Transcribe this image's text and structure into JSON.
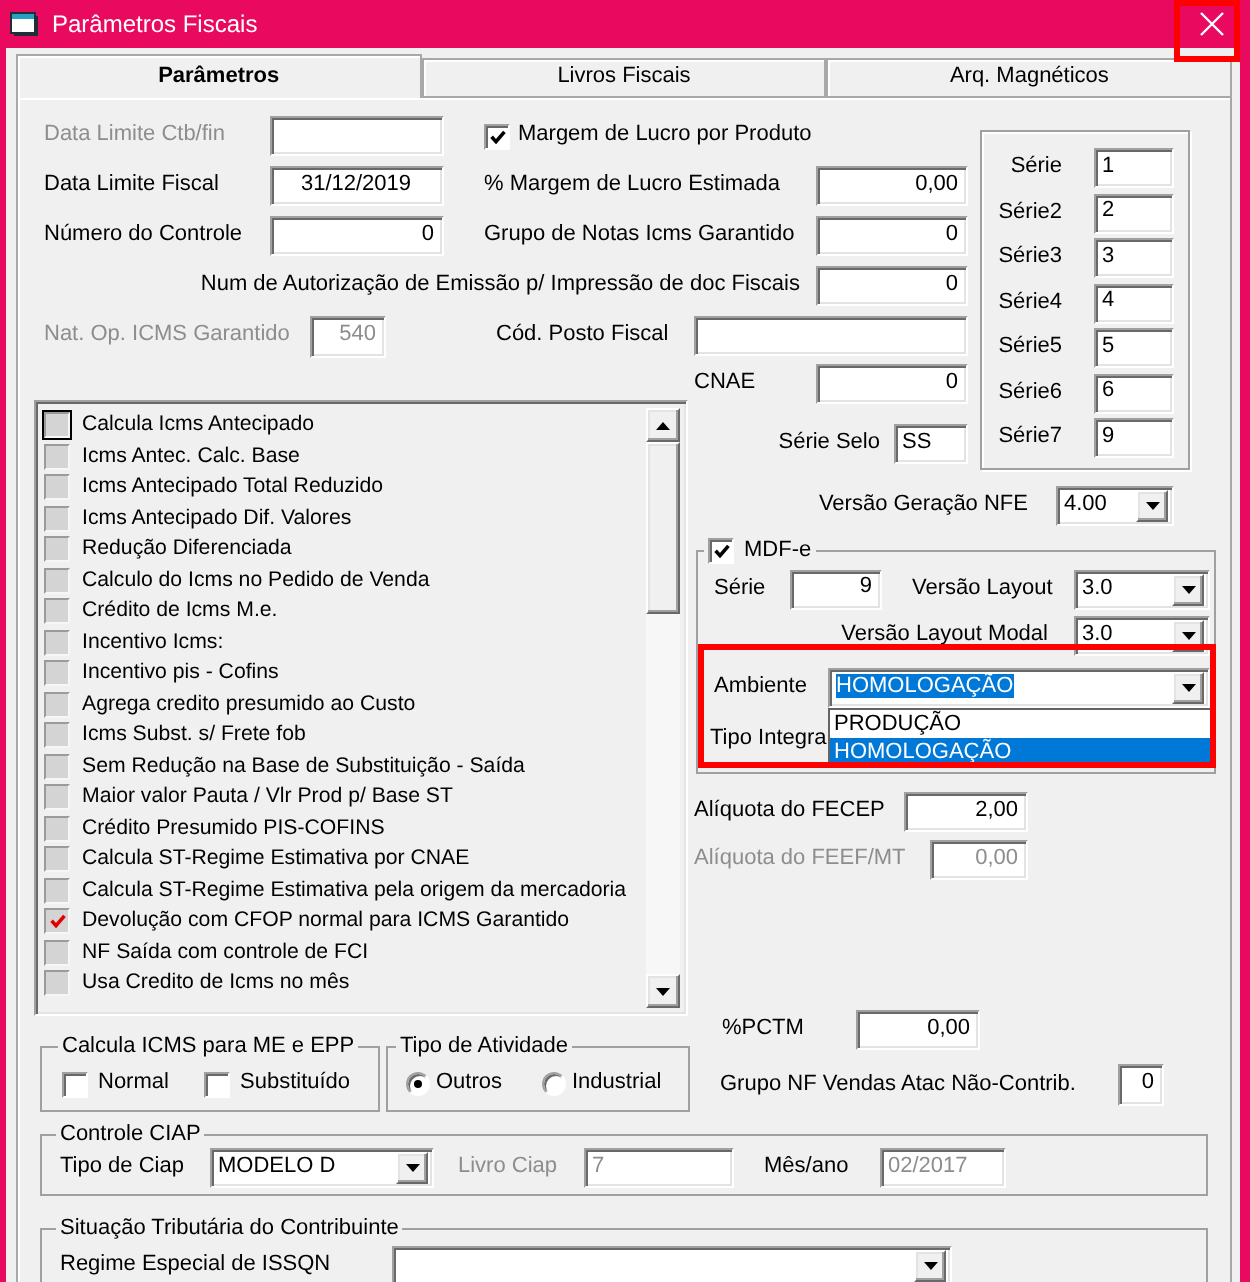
{
  "window": {
    "title": "Parâmetros Fiscais"
  },
  "tabs": [
    {
      "label": "Parâmetros",
      "selected": true
    },
    {
      "label": "Livros Fiscais",
      "selected": false
    },
    {
      "label": "Arq. Magnéticos",
      "selected": false
    }
  ],
  "left_fields": [
    {
      "label": "Data Limite Ctb/fin",
      "label_disabled": true,
      "disabled": false
    },
    {
      "label": "Data Limite Fiscal",
      "value": "31/12/2019",
      "label_disabled": false,
      "disabled": false
    },
    {
      "label": "Número do Controle",
      "value": "0",
      "label_disabled": false,
      "disabled": false
    }
  ],
  "margem_por_produto": {
    "label": "Margem de Lucro por Produto",
    "checked": true
  },
  "right_fields": [
    {
      "label": "% Margem de Lucro Estimada",
      "value": "0,00"
    },
    {
      "label": "Grupo de Notas Icms Garantido",
      "value": "0"
    },
    {
      "label": "Num de Autorização de Emissão p/ Impressão de doc Fiscais",
      "value": "0"
    }
  ],
  "nat_op_icms_garantido": {
    "label": "Nat. Op. ICMS Garantido",
    "value": "540",
    "label_disabled": true,
    "disabled": true
  },
  "cod_posto_fiscal": {
    "label": "Cód. Posto Fiscal"
  },
  "cnae": {
    "label": "CNAE",
    "value": "0"
  },
  "serie_selo": {
    "label": "Série Selo",
    "value": "SS"
  },
  "series": [
    {
      "label": "Série",
      "value": "1"
    },
    {
      "label": "Série2",
      "value": "2"
    },
    {
      "label": "Série3",
      "value": "3"
    },
    {
      "label": "Série4",
      "value": "4"
    },
    {
      "label": "Série5",
      "value": "5"
    },
    {
      "label": "Série6",
      "value": "6"
    },
    {
      "label": "Série7",
      "value": "9"
    }
  ],
  "options": [
    {
      "label": "Calcula Icms Antecipado",
      "checked": false,
      "focused": true
    },
    {
      "label": "Icms Antec. Calc. Base",
      "checked": false,
      "focused": false
    },
    {
      "label": "Icms Antecipado Total Reduzido",
      "checked": false,
      "focused": false
    },
    {
      "label": "Icms Antecipado Dif. Valores",
      "checked": false,
      "focused": false
    },
    {
      "label": "Redução Diferenciada",
      "checked": false,
      "focused": false
    },
    {
      "label": "Calculo do Icms no Pedido de Venda",
      "checked": false,
      "focused": false
    },
    {
      "label": "Crédito de Icms M.e.",
      "checked": false,
      "focused": false
    },
    {
      "label": "Incentivo Icms:",
      "checked": false,
      "focused": false
    },
    {
      "label": "Incentivo pis - Cofins",
      "checked": false,
      "focused": false
    },
    {
      "label": "Agrega credito presumido ao Custo",
      "checked": false,
      "focused": false
    },
    {
      "label": "Icms Subst. s/ Frete fob",
      "checked": false,
      "focused": false
    },
    {
      "label": "Sem Redução na Base de Substituição - Saída",
      "checked": false,
      "focused": false
    },
    {
      "label": "Maior valor Pauta / Vlr Prod p/ Base ST",
      "checked": false,
      "focused": false
    },
    {
      "label": "Crédito Presumido PIS-COFINS",
      "checked": false,
      "focused": false
    },
    {
      "label": "Calcula ST-Regime Estimativa por CNAE",
      "checked": false,
      "focused": false
    },
    {
      "label": "Calcula ST-Regime Estimativa pela origem da mercadoria",
      "checked": false,
      "focused": false
    },
    {
      "label": "Devolução com CFOP normal para ICMS Garantido",
      "checked": true,
      "focused": false
    },
    {
      "label": "NF Saída com controle de FCI",
      "checked": false,
      "focused": false
    },
    {
      "label": "Usa Credito de Icms no mês",
      "checked": false,
      "focused": false
    }
  ],
  "versao_geracao_nfe": {
    "label": "Versão Geração NFE",
    "value": "4.00"
  },
  "mdfe": {
    "label": "MDF-e",
    "checked": true,
    "serie": {
      "label": "Série",
      "value": "9"
    },
    "versao_layout": {
      "label": "Versão Layout",
      "value": "3.0"
    },
    "versao_layout_modal": {
      "label": "Versão Layout Modal",
      "value": "3.0"
    },
    "ambiente": {
      "label": "Ambiente",
      "value": "HOMOLOGAÇÃO",
      "expanded": true,
      "options": [
        {
          "label": "PRODUÇÃO",
          "selected": false
        },
        {
          "label": "HOMOLOGAÇÃO",
          "selected": true
        }
      ]
    },
    "tipo_integra": {
      "label": "Tipo Integra"
    }
  },
  "aliquota_fecep": {
    "label": "Alíquota do FECEP",
    "value": "2,00"
  },
  "aliquota_feef_mt": {
    "label": "Alíquota do FEEF/MT",
    "value": "0,00",
    "label_disabled": true,
    "disabled": true
  },
  "pctm": {
    "label": "%PCTM",
    "value": "0,00"
  },
  "grupo_nf_vendas_atac": {
    "label": "Grupo NF Vendas Atac Não-Contrib.",
    "value": "0"
  },
  "calcula_icms_me_epp": {
    "title": "Calcula ICMS para ME e EPP",
    "options": [
      {
        "label": "Normal",
        "checked": false
      },
      {
        "label": "Substituído",
        "checked": false
      }
    ]
  },
  "tipo_atividade": {
    "title": "Tipo de Atividade",
    "options": [
      {
        "label": "Outros",
        "selected": true
      },
      {
        "label": "Industrial",
        "selected": false
      }
    ]
  },
  "controle_ciap": {
    "title": "Controle CIAP",
    "tipo_ciap": {
      "label": "Tipo de Ciap",
      "value": "MODELO D"
    },
    "livro_ciap": {
      "label": "Livro Ciap",
      "value": "7",
      "label_disabled": true,
      "disabled": true
    },
    "mes_ano": {
      "label": "Mês/ano",
      "value": "02/2017",
      "label_disabled": false,
      "disabled": true
    }
  },
  "situacao_tributaria": {
    "title": "Situação Tributária do Contribuinte",
    "regime_especial_issqn": {
      "label": "Regime Especial de ISSQN"
    }
  }
}
